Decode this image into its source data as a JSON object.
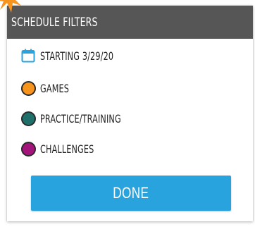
{
  "header": {
    "title": "SCHEDULE FILTERS"
  },
  "filters": {
    "date": {
      "label": "STARTING 3/29/20",
      "icon": "calendar-icon",
      "color": "#29a3dd"
    },
    "items": [
      {
        "label": "GAMES",
        "color": "#f7941d",
        "icon": "circle-icon"
      },
      {
        "label": "PRACTICE/TRAINING",
        "color": "#1f6f6b",
        "icon": "circle-icon"
      },
      {
        "label": "CHALLENGES",
        "color": "#a3157a",
        "icon": "circle-icon"
      }
    ]
  },
  "actions": {
    "done_label": "DONE",
    "done_color": "#29a3dd"
  },
  "decoration": {
    "burst_color": "#f7941d",
    "header_color": "#565656"
  }
}
